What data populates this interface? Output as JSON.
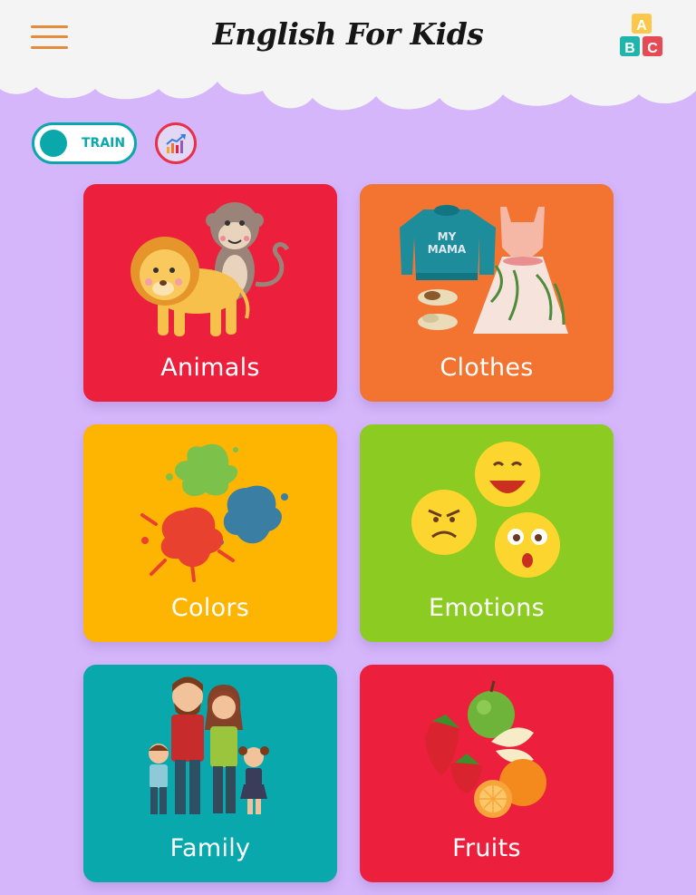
{
  "header": {
    "title": "English For Kids",
    "menu_icon": "hamburger-menu-icon",
    "logo_icon": "abc-blocks-icon",
    "logo_letters": [
      "A",
      "B",
      "C"
    ]
  },
  "controls": {
    "mode_toggle_label": "TRAIN",
    "stats_icon": "statistics-chart-icon"
  },
  "colors": {
    "background": "#d5b6fb",
    "header": "#f4f4f4",
    "menu": "#e58b3a",
    "toggle": "#0ba8ab",
    "stats_ring": "#e8304b"
  },
  "categories": [
    {
      "name": "Animals",
      "color": "#ec1f3c",
      "icon": "lion-monkey-icon"
    },
    {
      "name": "Clothes",
      "color": "#f27430",
      "icon": "sweater-dress-icon"
    },
    {
      "name": "Colors",
      "color": "#fdb502",
      "icon": "paint-splash-icon"
    },
    {
      "name": "Emotions",
      "color": "#8ccb21",
      "icon": "emoji-faces-icon"
    },
    {
      "name": "Family",
      "color": "#08a8ad",
      "icon": "family-people-icon"
    },
    {
      "name": "Fruits",
      "color": "#ec1f3c",
      "icon": "fruits-icon"
    }
  ]
}
